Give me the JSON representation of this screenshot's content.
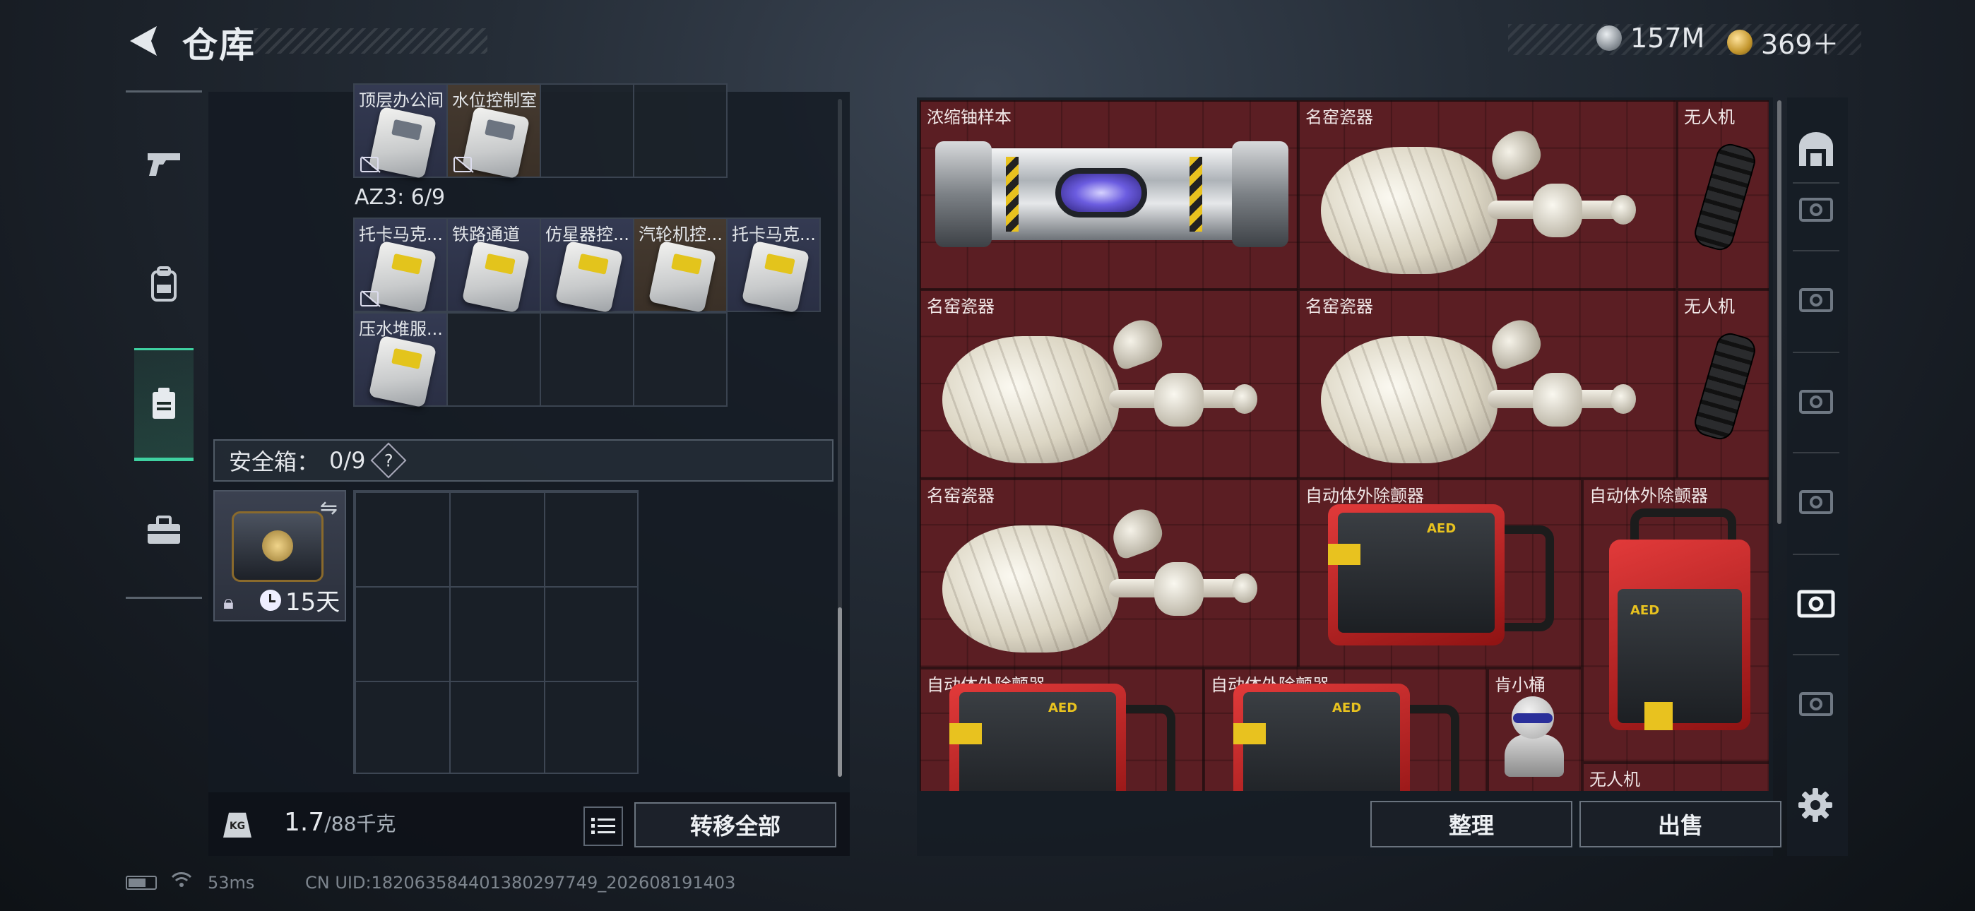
{
  "header": {
    "title": "仓库",
    "currency_silver": "157M",
    "currency_gold": "369＋"
  },
  "left_categories": [
    "weapon-icon",
    "backpack-icon",
    "container-icon",
    "toolbox-icon"
  ],
  "stash": {
    "top_row": [
      {
        "name": "顶层办公间",
        "style": "blue",
        "card": "grey",
        "no_power": true
      },
      {
        "name": "水位控制室",
        "style": "orange",
        "card": "grey",
        "no_power": true
      },
      {
        "name": "",
        "style": "empty"
      },
      {
        "name": "",
        "style": "empty"
      }
    ],
    "az3_label": "AZ3: 6/9",
    "az3_row1": [
      {
        "name": "托卡马克...",
        "style": "blue",
        "card": "yellow",
        "no_power": true
      },
      {
        "name": "铁路通道",
        "style": "blue",
        "card": "yellow"
      },
      {
        "name": "仿星器控...",
        "style": "blue",
        "card": "yellow"
      },
      {
        "name": "汽轮机控...",
        "style": "orange",
        "card": "yellow"
      },
      {
        "name": "托卡马克...",
        "style": "blue",
        "card": "yellow"
      }
    ],
    "az3_row2": [
      {
        "name": "压水堆服...",
        "style": "blue",
        "card": "yellow"
      },
      {
        "name": "",
        "style": "empty"
      },
      {
        "name": "",
        "style": "empty"
      },
      {
        "name": "",
        "style": "empty"
      }
    ]
  },
  "safe_box": {
    "label": "安全箱：",
    "count": "0/9",
    "help": "?",
    "days": "15天"
  },
  "weight": {
    "kg_label": "KG",
    "current": "1.7",
    "capacity": "/88千克"
  },
  "buttons": {
    "transfer_all": "转移全部",
    "sort": "整理",
    "sell": "出售"
  },
  "storage_items": {
    "i1": "浓缩铀样本",
    "i2": "名窑瓷器",
    "i3": "无人机",
    "i4": "名窑瓷器",
    "i5": "名窑瓷器",
    "i6": "无人机",
    "i7": "名窑瓷器",
    "i8": "自动体外除颤器",
    "i9": "自动体外除颤器",
    "i10": "自动体外除颤器",
    "i11": "自动体外除颤器",
    "i12": "肯小桶",
    "i13": "无人机"
  },
  "status": {
    "ping": "53ms",
    "uid": "CN UID:1820635844013802977​49_202608191403"
  },
  "colors": {
    "accent": "#3fd1a1",
    "storage_bg": "#5b1e23"
  }
}
